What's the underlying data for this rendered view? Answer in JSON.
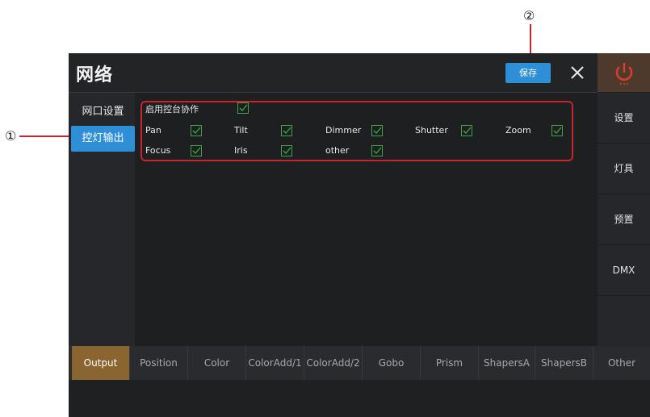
{
  "annotations": {
    "marker_1": "①",
    "marker_2": "②"
  },
  "window": {
    "title": "网络"
  },
  "toolbar": {
    "save_label": "保存",
    "close_icon": "close-icon",
    "power_icon": "power-icon"
  },
  "left_nav": {
    "items": [
      {
        "label": "网口设置"
      },
      {
        "label": "控灯输出"
      }
    ]
  },
  "settings": {
    "enable_console": {
      "label": "启用控台协作",
      "checked": true
    },
    "attributes": [
      {
        "label": "Pan",
        "checked": true
      },
      {
        "label": "Tilt",
        "checked": true
      },
      {
        "label": "Dimmer",
        "checked": true
      },
      {
        "label": "Shutter",
        "checked": true
      },
      {
        "label": "Zoom",
        "checked": true
      },
      {
        "label": "Focus",
        "checked": true
      },
      {
        "label": "Iris",
        "checked": true
      },
      {
        "label": "other",
        "checked": true
      }
    ]
  },
  "right_nav": {
    "items": [
      {
        "label": "设置"
      },
      {
        "label": "灯具"
      },
      {
        "label": "预置"
      },
      {
        "label": "DMX"
      }
    ]
  },
  "bottom_tabs": {
    "active": "Output",
    "items": [
      {
        "label": "Output"
      },
      {
        "label": "Position"
      },
      {
        "label": "Color"
      },
      {
        "label": "ColorAdd/1"
      },
      {
        "label": "ColorAdd/2"
      },
      {
        "label": "Gobo"
      },
      {
        "label": "Prism"
      },
      {
        "label": "ShapersA"
      },
      {
        "label": "ShapersB"
      },
      {
        "label": "Other"
      }
    ]
  },
  "colors": {
    "accent_blue": "#2f8fd6",
    "active_tab": "#8a6530",
    "check_green": "#3fa34d",
    "annotation_red": "#c8242b",
    "power_red": "#e23a2a"
  }
}
